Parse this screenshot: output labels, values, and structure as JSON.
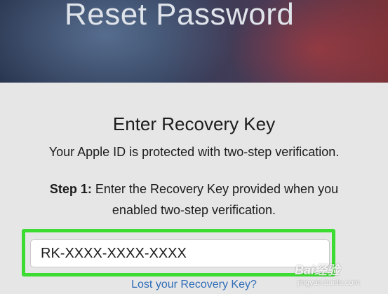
{
  "header": {
    "title": "Reset Password"
  },
  "content": {
    "heading": "Enter Recovery Key",
    "protected_text": "Your Apple ID is protected with two-step verification.",
    "step_label": "Step 1:",
    "step_text_line1": " Enter the Recovery Key provided when you",
    "step_text_line2": "enabled two-step verification."
  },
  "recovery_key": {
    "value": "RK-XXXX-XXXX-XXXX",
    "highlight_color": "#3ddc32"
  },
  "links": {
    "lost_key": "Lost your Recovery Key?"
  },
  "watermark": {
    "brand": "Bai经验",
    "site": "jingyan.baidu.com"
  },
  "colors": {
    "link": "#2f6db8",
    "background": "#e6e6e6"
  }
}
